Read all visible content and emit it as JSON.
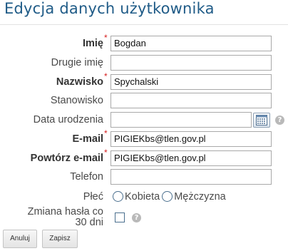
{
  "page": {
    "title": "Edycja danych użytkownika"
  },
  "form": {
    "first_name": {
      "label": "Imię",
      "required": "*",
      "value": "Bogdan"
    },
    "middle_name": {
      "label": "Drugie imię",
      "value": ""
    },
    "last_name": {
      "label": "Nazwisko",
      "required": "*",
      "value": "Spychalski"
    },
    "position": {
      "label": "Stanowisko",
      "value": ""
    },
    "birth_date": {
      "label": "Data urodzenia",
      "value": "",
      "calendar_icon": "calendar-icon",
      "help_icon": "help-icon",
      "help_glyph": "?"
    },
    "email": {
      "label": "E-mail",
      "required": "*",
      "value": "PIGIEKbs@tlen.gov.pl"
    },
    "email_repeat": {
      "label": "Powtórz e-mail",
      "required": "*",
      "value": "PIGIEKbs@tlen.gov.pl"
    },
    "phone": {
      "label": "Telefon",
      "value": ""
    },
    "gender": {
      "label": "Płeć",
      "options": [
        {
          "label": "Kobieta",
          "selected": false
        },
        {
          "label": "Mężczyzna",
          "selected": false
        }
      ]
    },
    "password_change": {
      "label_line1": "Zmiana hasła co",
      "label_line2": "30 dni",
      "checked": false,
      "help_icon": "help-icon",
      "help_glyph": "?"
    }
  },
  "actions": {
    "cancel_label": "Anuluj",
    "save_label": "Zapisz"
  },
  "colors": {
    "title": "#1f5b87",
    "required_marker": "#d62020",
    "input_border": "#a9a9a9"
  }
}
